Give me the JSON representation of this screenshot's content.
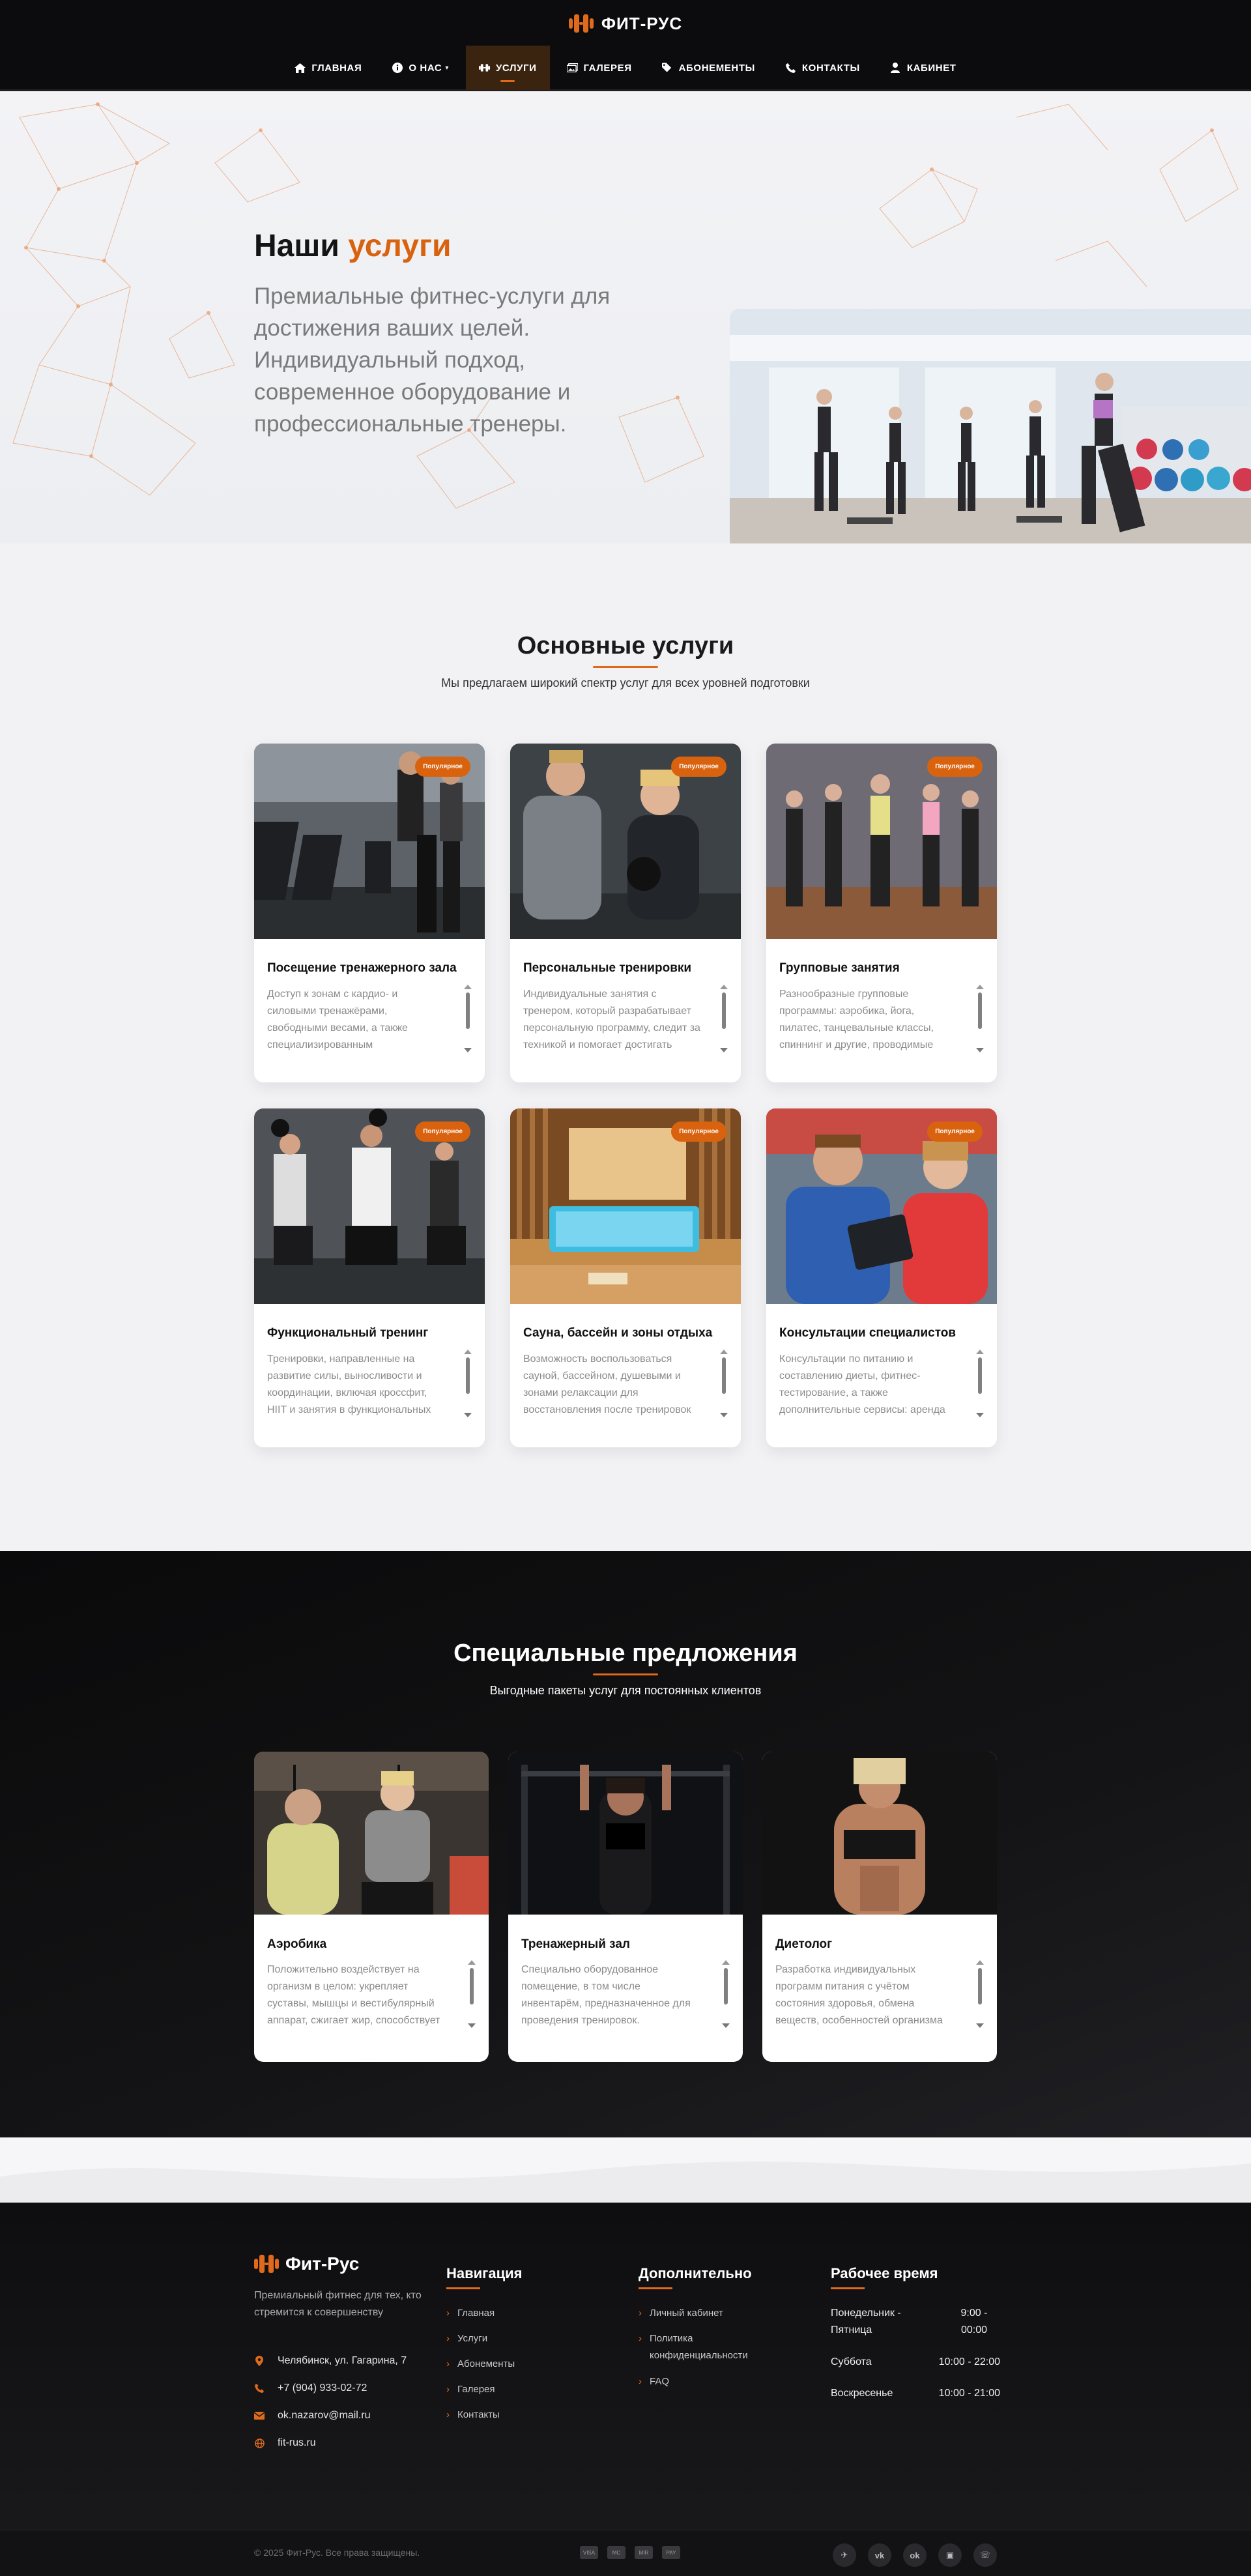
{
  "brand": {
    "name": "ФИТ-РУС",
    "footer_name": "Фит-Рус",
    "accent": "#e06a1b"
  },
  "nav": {
    "items": [
      {
        "label": "ГЛАВНАЯ",
        "icon": "home-icon"
      },
      {
        "label": "О НАС",
        "icon": "info-icon",
        "has_dropdown": true
      },
      {
        "label": "УСЛУГИ",
        "icon": "dumbbell-icon",
        "active": true
      },
      {
        "label": "ГАЛЕРЕЯ",
        "icon": "images-icon"
      },
      {
        "label": "АБОНЕМЕНТЫ",
        "icon": "tags-icon"
      },
      {
        "label": "КОНТАКТЫ",
        "icon": "phone-icon"
      },
      {
        "label": "КАБИНЕТ",
        "icon": "user-icon"
      }
    ]
  },
  "hero": {
    "title_plain": "Наши",
    "title_accent": "услуги",
    "description": "Премиальные фитнес-услуги для достижения ваших целей. Индивидуальный подход, современное оборудование и профессиональные тренеры."
  },
  "services": {
    "title": "Основные услуги",
    "subtitle": "Мы предлагаем широкий спектр услуг для всех уровней подготовки",
    "badge": "Популярное",
    "items": [
      {
        "title": "Посещение тренажерного зала",
        "text": "Доступ к зонам с кардио- и силовыми тренажёрами, свободными весами, а также специализированным оборудованием для"
      },
      {
        "title": "Персональные тренировки",
        "text": "Индивидуальные занятия с тренером, который разрабатывает персональную программу, следит за техникой и помогает достигать"
      },
      {
        "title": "Групповые занятия",
        "text": "Разнообразные групповые программы: аэробика, йога, пилатес, танцевальные классы, спиннинг и другие, проводимые"
      },
      {
        "title": "Функциональный тренинг",
        "text": "Тренировки, направленные на развитие силы, выносливости и координации, включая кроссфит, HIIT и занятия в функциональных"
      },
      {
        "title": "Сауна, бассейн и зоны отдыха",
        "text": "Возможность воспользоваться сауной, бассейном, душевыми и зонами релаксации для восстановления после тренировок"
      },
      {
        "title": "Консультации специалистов",
        "text": "Консультации по питанию и составлению диеты, фитнес-тестирование, а также дополнительные сервисы: аренда"
      }
    ]
  },
  "specials": {
    "title": "Специальные предложения",
    "subtitle": "Выгодные пакеты услуг для постоянных клиентов",
    "items": [
      {
        "title": "Аэробика",
        "text": "Положительно воздействует на организм в целом: укрепляет суставы, мышцы и вестибулярный аппарат, сжигает жир, способствует"
      },
      {
        "title": "Тренажерный зал",
        "text": "Специально оборудованное помещение, в том числе инвентарём, предназначенное для проведения тренировок."
      },
      {
        "title": "Диетолог",
        "text": "Разработка индивидуальных программ питания с учётом состояния здоровья, обмена веществ, особенностей организма"
      }
    ]
  },
  "footer": {
    "description": "Премиальный фитнес для тех, кто стремится к совершенству",
    "contacts": [
      {
        "icon": "map-pin-icon",
        "text": "Челябинск, ул. Гагарина, 7"
      },
      {
        "icon": "phone-icon",
        "text": "+7 (904) 933-02-72"
      },
      {
        "icon": "mail-icon",
        "text": "ok.nazarov@mail.ru"
      },
      {
        "icon": "globe-icon",
        "text": "fit-rus.ru"
      }
    ],
    "nav_title": "Навигация",
    "nav_links": [
      "Главная",
      "Услуги",
      "Абонементы",
      "Галерея",
      "Контакты"
    ],
    "extra_title": "Дополнительно",
    "extra_links": [
      "Личный кабинет",
      "Политика конфиденциальности",
      "FAQ"
    ],
    "hours_title": "Рабочее время",
    "hours": [
      {
        "day": "Понедельник - Пятница",
        "time": "9:00 - 00:00"
      },
      {
        "day": "Суббота",
        "time": "10:00 - 22:00"
      },
      {
        "day": "Воскресенье",
        "time": "10:00 - 21:00"
      }
    ],
    "copyright": "© 2025 Фит-Рус. Все права защищены.",
    "payment_icons": [
      "VISA",
      "MC",
      "MIR",
      "PAY"
    ],
    "socials": [
      {
        "icon": "telegram-icon",
        "glyph": "✈"
      },
      {
        "icon": "vk-icon",
        "glyph": "vk"
      },
      {
        "icon": "odnoklassniki-icon",
        "glyph": "ok"
      },
      {
        "icon": "twitch-icon",
        "glyph": "▣"
      },
      {
        "icon": "whatsapp-icon",
        "glyph": "☏"
      }
    ]
  }
}
